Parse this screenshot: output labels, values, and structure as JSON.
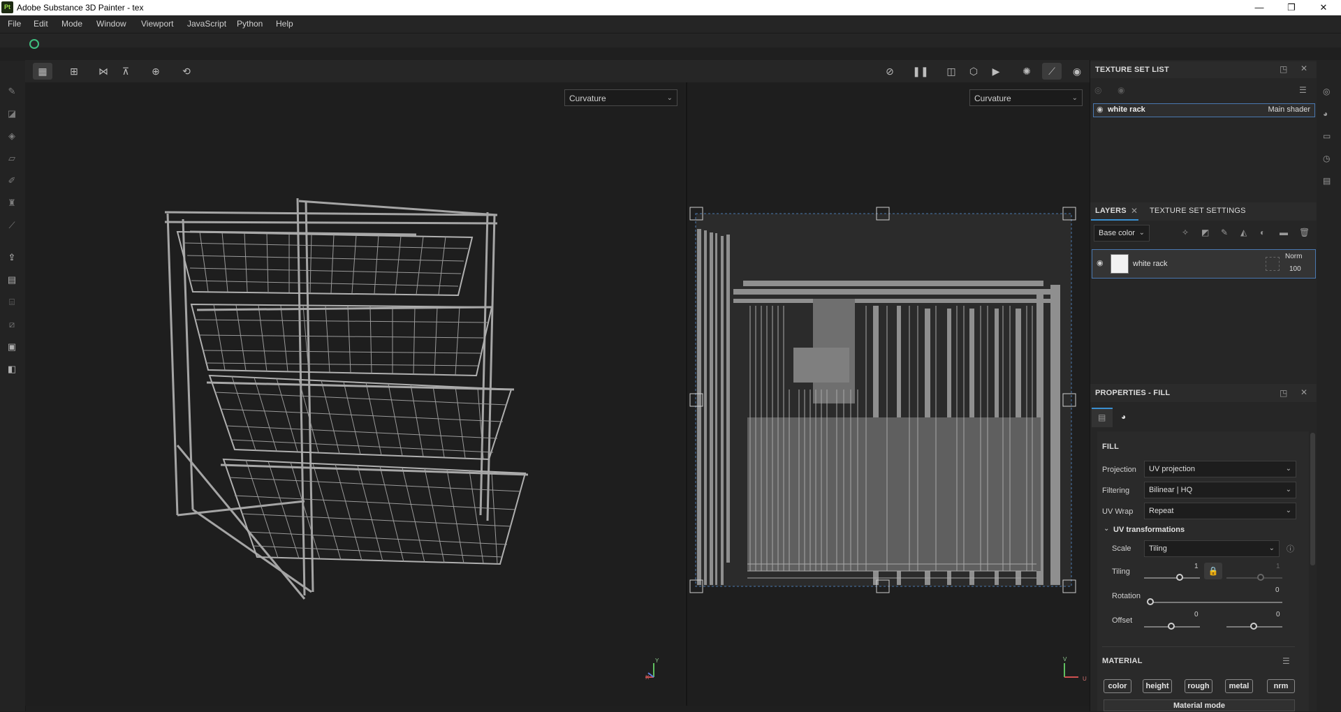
{
  "app": {
    "icon_text": "Pt",
    "title": "Adobe Substance 3D Painter - tex",
    "window_controls": {
      "minimize": "—",
      "maximize": "❐",
      "close": "✕"
    }
  },
  "menu": [
    "File",
    "Edit",
    "Mode",
    "Window",
    "Viewport",
    "JavaScript",
    "Python",
    "Help"
  ],
  "viewport_3d": {
    "channel_dropdown": "Curvature",
    "axis": {
      "y": "Y",
      "x": "X"
    }
  },
  "viewport_2d": {
    "channel_dropdown": "Curvature",
    "axis": {
      "y": "V",
      "x": "U"
    }
  },
  "texture_set_list": {
    "title": "TEXTURE SET LIST",
    "item": {
      "name": "white rack",
      "shader": "Main shader"
    }
  },
  "layers": {
    "tabs": [
      "LAYERS",
      "TEXTURE SET SETTINGS"
    ],
    "channel": "Base color",
    "layer": {
      "name": "white rack",
      "blend": "Norm",
      "opacity": "100"
    }
  },
  "properties": {
    "title": "PROPERTIES - FILL",
    "section": "FILL",
    "fields": [
      {
        "label": "Projection",
        "value": "UV projection"
      },
      {
        "label": "Filtering",
        "value": "Bilinear | HQ"
      },
      {
        "label": "UV Wrap",
        "value": "Repeat"
      }
    ],
    "uv_transformations": {
      "title": "UV transformations",
      "scale_label": "Scale",
      "scale_value": "Tiling",
      "tiling_label": "Tiling",
      "tiling_u": "1",
      "tiling_v": "1",
      "rotation_label": "Rotation",
      "rotation_value": "0",
      "offset_label": "Offset",
      "offset_u": "0",
      "offset_v": "0"
    },
    "material": {
      "title": "MATERIAL",
      "channels": [
        "color",
        "height",
        "rough",
        "metal",
        "nrm"
      ],
      "mode_label": "Material mode"
    }
  }
}
